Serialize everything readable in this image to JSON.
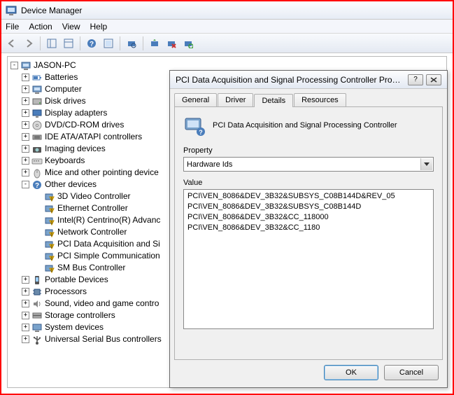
{
  "window": {
    "title": "Device Manager"
  },
  "menu": {
    "file": "File",
    "action": "Action",
    "view": "View",
    "help": "Help"
  },
  "tree": {
    "root": "JASON-PC",
    "items": [
      {
        "label": "Batteries"
      },
      {
        "label": "Computer"
      },
      {
        "label": "Disk drives"
      },
      {
        "label": "Display adapters"
      },
      {
        "label": "DVD/CD-ROM drives"
      },
      {
        "label": "IDE ATA/ATAPI controllers"
      },
      {
        "label": "Imaging devices"
      },
      {
        "label": "Keyboards"
      },
      {
        "label": "Mice and other pointing device"
      },
      {
        "label": "Other devices",
        "expanded": true,
        "children": [
          {
            "label": "3D Video Controller"
          },
          {
            "label": "Ethernet Controller"
          },
          {
            "label": "Intel(R) Centrino(R) Advanc"
          },
          {
            "label": "Network Controller"
          },
          {
            "label": "PCI Data Acquisition and Si"
          },
          {
            "label": "PCI Simple Communication"
          },
          {
            "label": "SM Bus Controller"
          }
        ]
      },
      {
        "label": "Portable Devices"
      },
      {
        "label": "Processors"
      },
      {
        "label": "Sound, video and game contro"
      },
      {
        "label": "Storage controllers"
      },
      {
        "label": "System devices"
      },
      {
        "label": "Universal Serial Bus controllers"
      }
    ]
  },
  "dialog": {
    "title": "PCI Data Acquisition and Signal Processing Controller Proper...",
    "tabs": {
      "general": "General",
      "driver": "Driver",
      "details": "Details",
      "resources": "Resources"
    },
    "device_name": "PCI Data Acquisition and Signal Processing Controller",
    "property_label": "Property",
    "property_value": "Hardware Ids",
    "value_label": "Value",
    "values": [
      "PCI\\VEN_8086&DEV_3B32&SUBSYS_C08B144D&REV_05",
      "PCI\\VEN_8086&DEV_3B32&SUBSYS_C08B144D",
      "PCI\\VEN_8086&DEV_3B32&CC_118000",
      "PCI\\VEN_8086&DEV_3B32&CC_1180"
    ],
    "ok": "OK",
    "cancel": "Cancel"
  }
}
